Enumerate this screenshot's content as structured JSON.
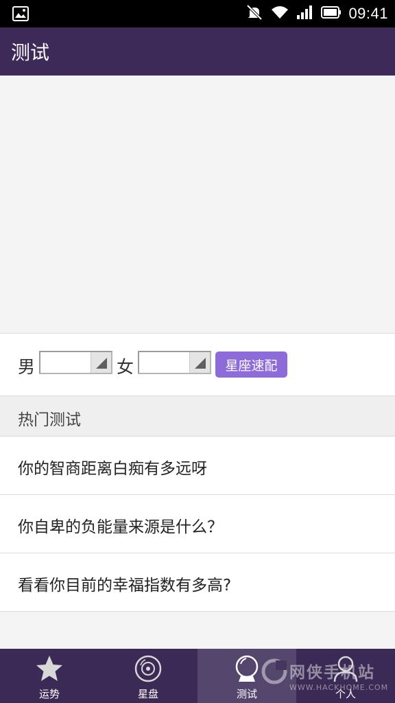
{
  "status_bar": {
    "time": "09:41",
    "icons": [
      "image-icon",
      "muted-icon",
      "wifi-icon",
      "signal-icon",
      "battery-icon"
    ]
  },
  "header": {
    "title": "测试"
  },
  "match": {
    "male_label": "男",
    "female_label": "女",
    "male_value": "",
    "female_value": "",
    "button_label": "星座速配"
  },
  "hot_tests": {
    "title": "热门测试",
    "items": [
      {
        "label": "你的智商距离白痴有多远呀"
      },
      {
        "label": "你自卑的负能量来源是什么？"
      },
      {
        "label": "看看你目前的幸福指数有多高?"
      }
    ]
  },
  "tabs": [
    {
      "label": "运势",
      "icon": "star-icon"
    },
    {
      "label": "星盘",
      "icon": "disc-icon"
    },
    {
      "label": "测试",
      "icon": "crystal-ball-icon",
      "active": true
    },
    {
      "label": "个人",
      "icon": "user-icon"
    }
  ],
  "watermark": {
    "title": "网侠手机站",
    "subtitle": "WWW.HACKHOME.COM"
  },
  "colors": {
    "app_bar": "#3e2a58",
    "tab_bar": "#3b2a55",
    "accent_button": "#8d6bd9"
  }
}
